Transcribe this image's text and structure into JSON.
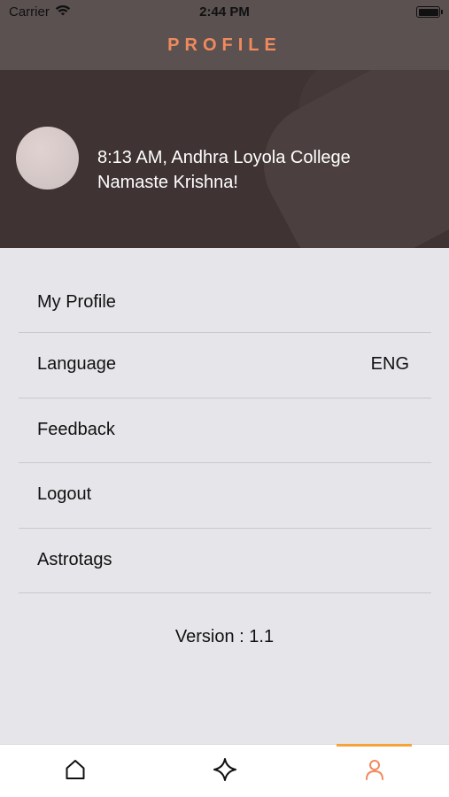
{
  "status_bar": {
    "carrier": "Carrier",
    "time": "2:44 PM",
    "icons": [
      "wifi-icon",
      "battery-icon"
    ]
  },
  "nav": {
    "title": "PROFILE",
    "title_color": "#f08a5d"
  },
  "header": {
    "greeting_line1": "8:13 AM, Andhra Loyola College",
    "greeting_line2": "Namaste Krishna!"
  },
  "menu": {
    "items": [
      {
        "label": "My Profile"
      },
      {
        "label": "Language",
        "value": "ENG"
      },
      {
        "label": "Feedback"
      },
      {
        "label": "Logout"
      },
      {
        "label": "Astrotags"
      }
    ]
  },
  "footer": {
    "version": "Version : 1.1"
  },
  "tab_bar": {
    "tabs": [
      {
        "icon": "home-icon",
        "active": false
      },
      {
        "icon": "star-icon",
        "active": false
      },
      {
        "icon": "person-icon",
        "active": true
      }
    ],
    "active_color": "#f08a5d",
    "indicator_color": "#f5a33a"
  }
}
